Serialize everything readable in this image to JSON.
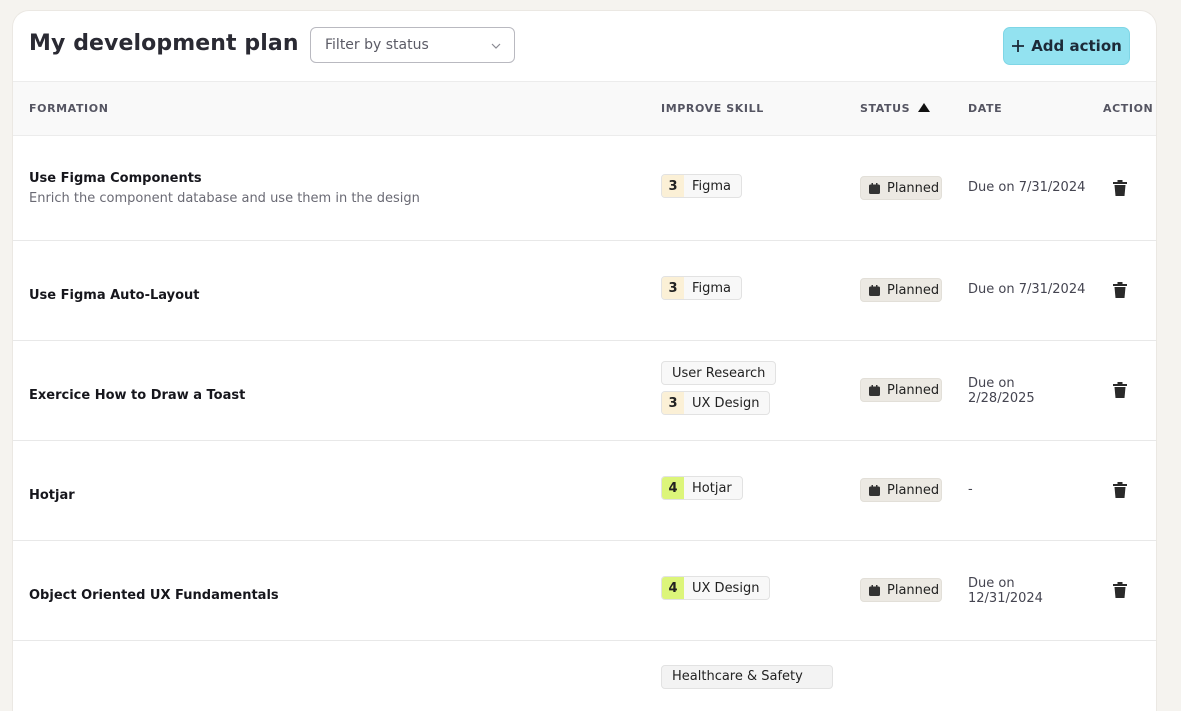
{
  "header": {
    "title": "My development plan",
    "filter_placeholder": "Filter by status",
    "add_label": "Add action",
    "accent": "#93e2f0"
  },
  "columns": {
    "formation": "FORMATION",
    "improve_skill": "IMPROVE SKILL",
    "status": "STATUS",
    "date": "DATE",
    "action": "ACTION",
    "status_sort": "ascending"
  },
  "rows": [
    {
      "title": "Use Figma Components",
      "description": "Enrich the component database and use them in the design",
      "skills": [
        {
          "level": "3",
          "name": "Figma"
        }
      ],
      "status": "Planned",
      "date_line1": "Due on 7/31/2024",
      "date_line2": ""
    },
    {
      "title": "Use Figma Auto-Layout",
      "description": "",
      "skills": [
        {
          "level": "3",
          "name": "Figma"
        }
      ],
      "status": "Planned",
      "date_line1": "Due on 7/31/2024",
      "date_line2": ""
    },
    {
      "title": "Exercice How to Draw a Toast",
      "description": "",
      "skills": [
        {
          "level": "",
          "name": "User Research"
        },
        {
          "level": "3",
          "name": "UX Design"
        }
      ],
      "status": "Planned",
      "date_line1": "Due on",
      "date_line2": "2/28/2025"
    },
    {
      "title": "Hotjar",
      "description": "",
      "skills": [
        {
          "level": "4",
          "name": "Hotjar"
        }
      ],
      "status": "Planned",
      "date_line1": "-",
      "date_line2": ""
    },
    {
      "title": "Object Oriented UX Fundamentals",
      "description": "",
      "skills": [
        {
          "level": "4",
          "name": "UX Design"
        }
      ],
      "status": "Planned",
      "date_line1": "Due on",
      "date_line2": "12/31/2024"
    }
  ],
  "partial_row": {
    "skill_name": "Healthcare & Safety"
  }
}
